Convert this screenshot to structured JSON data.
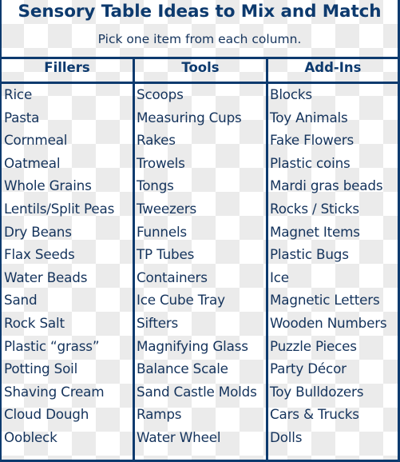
{
  "title": "Sensory Table Ideas to Mix and Match",
  "subtitle": "Pick one item from each column.",
  "colors": {
    "border": "#0d3a6e",
    "heading": "#0d3a6e",
    "text": "#14335c"
  },
  "columns": [
    {
      "header": "Fillers",
      "items": [
        "Rice",
        "Pasta",
        "Cornmeal",
        "Oatmeal",
        "Whole Grains",
        "Lentils/Split Peas",
        "Dry Beans",
        "Flax Seeds",
        "Water Beads",
        "Sand",
        "Rock Salt",
        "Plastic “grass”",
        "Potting Soil",
        "Shaving Cream",
        "Cloud Dough",
        "Oobleck"
      ]
    },
    {
      "header": "Tools",
      "items": [
        "Scoops",
        "Measuring Cups",
        "Rakes",
        "Trowels",
        "Tongs",
        "Tweezers",
        "Funnels",
        "TP Tubes",
        "Containers",
        "Ice Cube Tray",
        "Sifters",
        "Magnifying Glass",
        "Balance Scale",
        "Sand Castle Molds",
        "Ramps",
        "Water Wheel"
      ]
    },
    {
      "header": "Add-Ins",
      "items": [
        "Blocks",
        "Toy Animals",
        "Fake Flowers",
        "Plastic coins",
        "Mardi gras beads",
        "Rocks / Sticks",
        "Magnet Items",
        "Plastic Bugs",
        "Ice",
        "Magnetic Letters",
        "Wooden Numbers",
        "Puzzle Pieces",
        "Party Décor",
        "Toy Bulldozers",
        "Cars & Trucks",
        "Dolls"
      ]
    }
  ]
}
